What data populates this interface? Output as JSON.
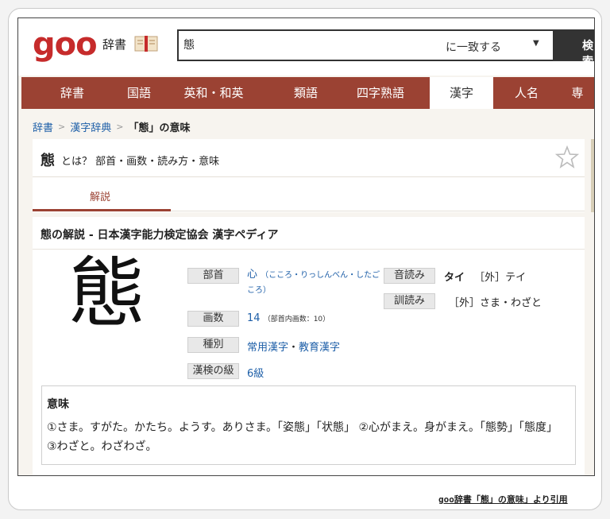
{
  "header": {
    "logo": "goo",
    "site_name": "辞書",
    "search": {
      "value": "態",
      "mode": "に一致する",
      "button": "検索"
    }
  },
  "nav": {
    "tabs": [
      {
        "label": "辞書"
      },
      {
        "label": "国語"
      },
      {
        "label": "英和・和英"
      },
      {
        "label": "類語"
      },
      {
        "label": "四字熟語"
      },
      {
        "label": "漢字"
      },
      {
        "label": "人名"
      },
      {
        "label": "専"
      }
    ],
    "active": "漢字"
  },
  "breadcrumb": {
    "items": [
      "辞書",
      "漢字辞典"
    ],
    "current": "「態」の意味"
  },
  "entry": {
    "kanji": "態",
    "title_rest": "とは？ 部首・画数・読み方・意味",
    "tab": "解説",
    "panel_title": "態の解説 - 日本漢字能力検定協会 漢字ペディア",
    "bushu_label": "部首",
    "bushu_value": "心",
    "bushu_reading": "（こころ・りっしんべん・したごころ）",
    "kakusu_label": "画数",
    "kakusu_value": "14",
    "kakusu_note": "（部首内画数：10）",
    "shubetsu_label": "種別",
    "shubetsu_value1": "常用漢字",
    "shubetsu_sep": "・",
    "shubetsu_value2": "教育漢字",
    "kanken_label": "漢検の級",
    "kanken_value": "6級",
    "on_label": "音読み",
    "on_value": "タイ",
    "on_extra": "［外］テイ",
    "kun_label": "訓読み",
    "kun_value": "［外］さま・わざと",
    "meaning_title": "意味",
    "meaning_text": "①さま。すがた。かたち。ようす。ありさま。「姿態」「状態」 ②心がまえ。身がまえ。「態勢」「態度」 ③わざと。わざわざ。"
  },
  "citation": "goo辞書「態」の意味」より引用",
  "colors": {
    "brand": "#c62b2b",
    "nav": "#9b4233",
    "link": "#1e5fa8"
  }
}
